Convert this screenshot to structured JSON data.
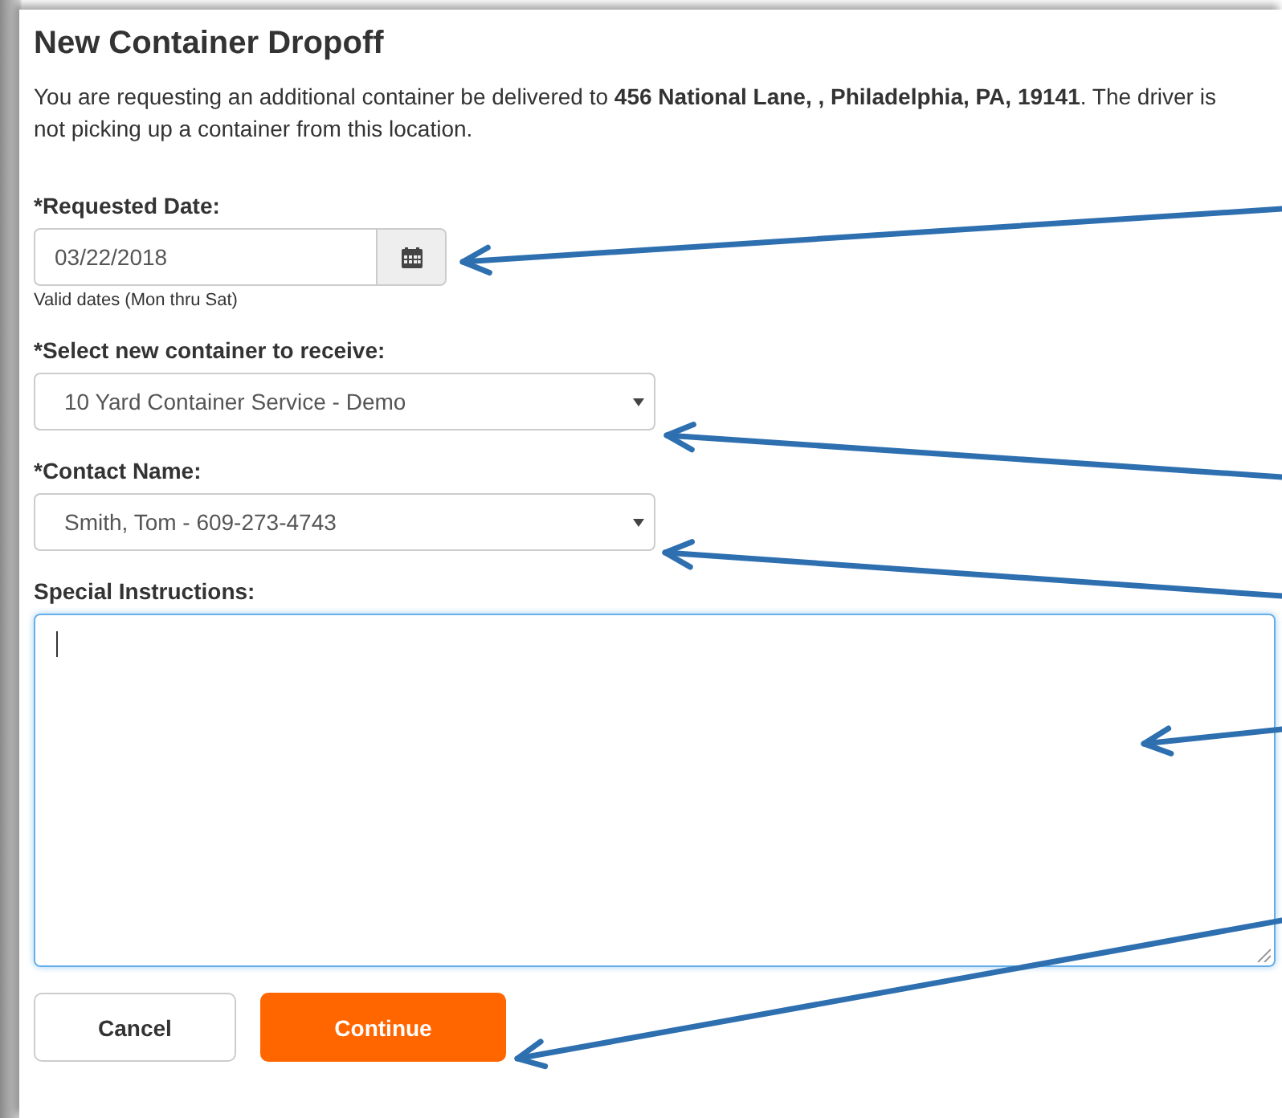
{
  "title": "New Container Dropoff",
  "intro": "You are requesting an additional container be delivered to **456 National Lane, , Philadelphia, PA, 19141**. The driver is not picking up a container from this location.",
  "fields": [
    {
      "kind": "date",
      "label": "*Requested Date:",
      "value": "03/22/2018",
      "hint": "Valid dates (Mon thru Sat)"
    },
    {
      "kind": "select",
      "label": "*Select new container to receive:",
      "value": "10 Yard Container Service - Demo"
    },
    {
      "kind": "select",
      "label": "*Contact Name:",
      "value": "Smith, Tom - 609-273-4743"
    },
    {
      "kind": "textarea",
      "label": "Special Instructions:",
      "focused": true
    }
  ],
  "buttons": [
    {
      "kind": "secondary",
      "label": "Cancel"
    },
    {
      "kind": "primary",
      "label": "Continue"
    }
  ]
}
